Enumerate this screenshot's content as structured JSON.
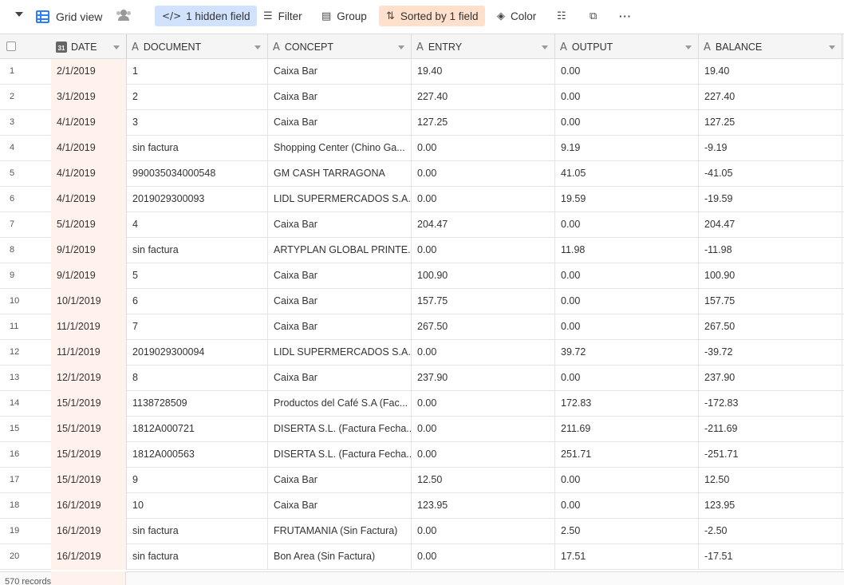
{
  "toolbar": {
    "view_name": "Grid view",
    "hidden_fields": "1 hidden field",
    "filter": "Filter",
    "group": "Group",
    "sort": "Sorted by 1 field",
    "color": "Color",
    "more": "···"
  },
  "columns": [
    {
      "name": "DATE",
      "type": "date",
      "type_icon": "31"
    },
    {
      "name": "DOCUMENT",
      "type": "text",
      "type_icon": "A"
    },
    {
      "name": "CONCEPT",
      "type": "text",
      "type_icon": "A"
    },
    {
      "name": "ENTRY",
      "type": "text",
      "type_icon": "A"
    },
    {
      "name": "OUTPUT",
      "type": "text",
      "type_icon": "A"
    },
    {
      "name": "BALANCE",
      "type": "text",
      "type_icon": "A"
    }
  ],
  "rows": [
    {
      "n": "1",
      "date": "2/1/2019",
      "document": "1",
      "concept": "Caixa Bar",
      "entry": "19.40",
      "output": "0.00",
      "balance": "19.40"
    },
    {
      "n": "2",
      "date": "3/1/2019",
      "document": "2",
      "concept": "Caixa Bar",
      "entry": "227.40",
      "output": "0.00",
      "balance": "227.40"
    },
    {
      "n": "3",
      "date": "4/1/2019",
      "document": "3",
      "concept": "Caixa Bar",
      "entry": "127.25",
      "output": "0.00",
      "balance": "127.25"
    },
    {
      "n": "4",
      "date": "4/1/2019",
      "document": "sin factura",
      "concept": "Shopping Center (Chino Ga...",
      "entry": "0.00",
      "output": "9.19",
      "balance": "-9.19"
    },
    {
      "n": "5",
      "date": "4/1/2019",
      "document": "990035034000548",
      "concept": "GM CASH TARRAGONA",
      "entry": "0.00",
      "output": "41.05",
      "balance": "-41.05"
    },
    {
      "n": "6",
      "date": "4/1/2019",
      "document": "2019029300093",
      "concept": "LIDL SUPERMERCADOS S.A...",
      "entry": "0.00",
      "output": "19.59",
      "balance": "-19.59"
    },
    {
      "n": "7",
      "date": "5/1/2019",
      "document": "4",
      "concept": "Caixa Bar",
      "entry": "204.47",
      "output": "0.00",
      "balance": "204.47"
    },
    {
      "n": "8",
      "date": "9/1/2019",
      "document": "sin factura",
      "concept": "ARTYPLAN GLOBAL PRINTE...",
      "entry": "0.00",
      "output": "11.98",
      "balance": "-11.98"
    },
    {
      "n": "9",
      "date": "9/1/2019",
      "document": "5",
      "concept": "Caixa Bar",
      "entry": "100.90",
      "output": "0.00",
      "balance": "100.90"
    },
    {
      "n": "10",
      "date": "10/1/2019",
      "document": "6",
      "concept": "Caixa Bar",
      "entry": "157.75",
      "output": "0.00",
      "balance": "157.75"
    },
    {
      "n": "11",
      "date": "11/1/2019",
      "document": "7",
      "concept": "Caixa Bar",
      "entry": "267.50",
      "output": "0.00",
      "balance": "267.50"
    },
    {
      "n": "12",
      "date": "11/1/2019",
      "document": "2019029300094",
      "concept": "LIDL SUPERMERCADOS S.A...",
      "entry": "0.00",
      "output": "39.72",
      "balance": "-39.72"
    },
    {
      "n": "13",
      "date": "12/1/2019",
      "document": "8",
      "concept": "Caixa Bar",
      "entry": "237.90",
      "output": "0.00",
      "balance": "237.90"
    },
    {
      "n": "14",
      "date": "15/1/2019",
      "document": "1138728509",
      "concept": "Productos del Café S.A (Fac...",
      "entry": "0.00",
      "output": "172.83",
      "balance": "-172.83"
    },
    {
      "n": "15",
      "date": "15/1/2019",
      "document": "1812A000721",
      "concept": "DISERTA S.L. (Factura Fecha...",
      "entry": "0.00",
      "output": "211.69",
      "balance": "-211.69"
    },
    {
      "n": "16",
      "date": "15/1/2019",
      "document": "1812A000563",
      "concept": "DISERTA S.L. (Factura Fecha...",
      "entry": "0.00",
      "output": "251.71",
      "balance": "-251.71"
    },
    {
      "n": "17",
      "date": "15/1/2019",
      "document": "9",
      "concept": "Caixa Bar",
      "entry": "12.50",
      "output": "0.00",
      "balance": "12.50"
    },
    {
      "n": "18",
      "date": "16/1/2019",
      "document": "10",
      "concept": "Caixa Bar",
      "entry": "123.95",
      "output": "0.00",
      "balance": "123.95"
    },
    {
      "n": "19",
      "date": "16/1/2019",
      "document": "sin factura",
      "concept": "FRUTAMANIA (Sin Factura)",
      "entry": "0.00",
      "output": "2.50",
      "balance": "-2.50"
    },
    {
      "n": "20",
      "date": "16/1/2019",
      "document": "sin factura",
      "concept": "Bon Area (Sin Factura)",
      "entry": "0.00",
      "output": "17.51",
      "balance": "-17.51"
    }
  ],
  "footer": {
    "records": "570 records"
  },
  "colors": {
    "accent_blue": "#2d7ff9",
    "hidden_bg": "#d1e2ff",
    "sort_bg": "#ffe0cc",
    "date_col_bg": "#fff1ec"
  }
}
